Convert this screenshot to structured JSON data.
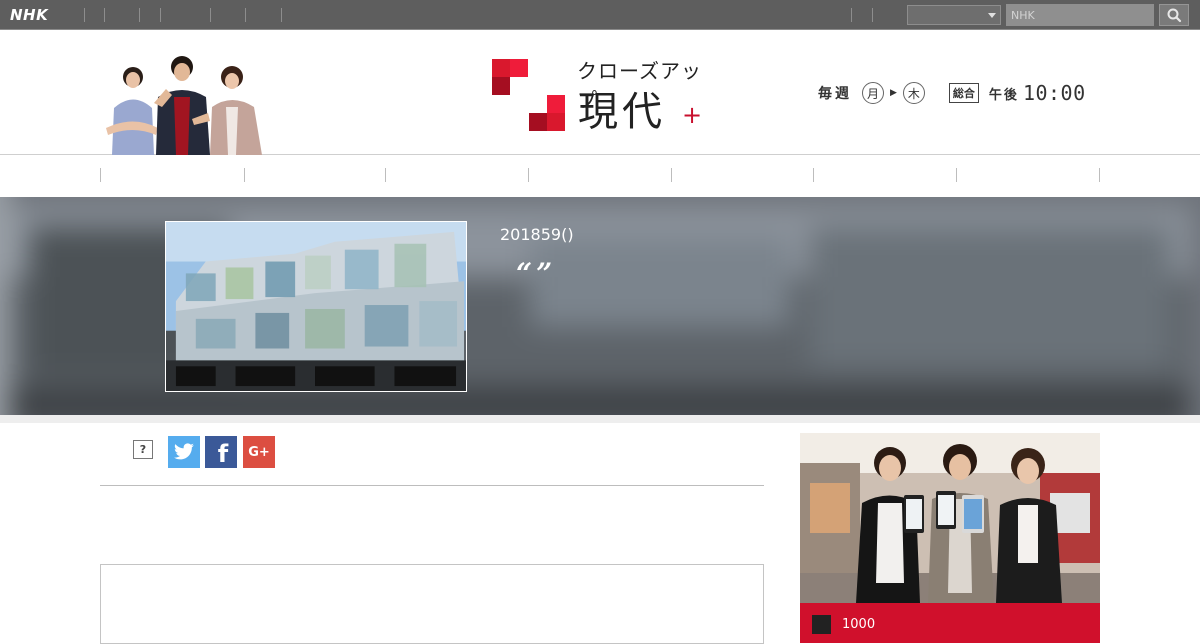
{
  "topbar": {
    "logo": "NHK",
    "search_placeholder": "NHK",
    "select_value": ""
  },
  "header": {
    "program_logo_top": "クローズアップ",
    "program_logo_main": "現代",
    "program_logo_plus": "+",
    "schedule": {
      "weekly": "毎週",
      "day_start": "月",
      "day_end": "木",
      "channel": "総合",
      "pm": "午後",
      "time": "10:00"
    }
  },
  "hero": {
    "date": "201859()",
    "title": "“”"
  },
  "share": {
    "help": "?",
    "twitter_icon": "twitter-icon",
    "facebook_label": "f",
    "gplus_label": "G+"
  },
  "promo": {
    "caption": "1000"
  },
  "colors": {
    "topbar": "#5e5e5e",
    "brand_red": "#c8102e",
    "promo_bar": "#d0102c",
    "twitter": "#55acee",
    "facebook": "#3b5998",
    "gplus": "#dc4e41"
  }
}
